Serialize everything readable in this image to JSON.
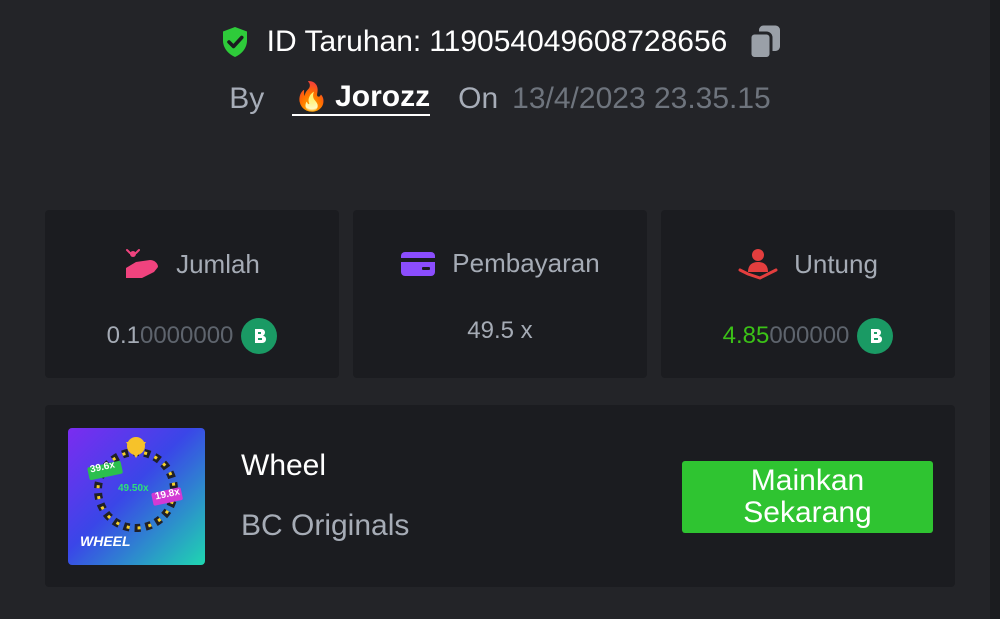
{
  "header": {
    "bet_id_label": "ID Taruhan:",
    "bet_id_value": "119054049608728656",
    "by_label": "By",
    "user": "Jorozz",
    "on_label": "On",
    "date": "13/4/2023 23.35.15"
  },
  "stats": [
    {
      "label": "Jumlah",
      "value_main": "0.1",
      "value_faded": "0000000",
      "icon": "coin-hand-icon",
      "icon_color": "#f0437e"
    },
    {
      "label": "Pembayaran",
      "value": "49.5 x",
      "icon": "card-icon",
      "icon_color": "#8b4dfd"
    },
    {
      "label": "Untung",
      "value_main": "4.85",
      "value_faded": "000000",
      "icon": "profit-hand-icon",
      "icon_color": "#e33e3e"
    }
  ],
  "game": {
    "title": "Wheel",
    "provider": "BC Originals",
    "thumb_text": "WHEEL",
    "thumb_multipliers": [
      "39.6x",
      "49.50x",
      "19.8x"
    ],
    "play_button": "Mainkan\nSekarang"
  },
  "colors": {
    "background": "#232428",
    "card": "#1b1c20",
    "accent_green": "#2fc431",
    "profit_green": "#3bc117",
    "muted_text": "#a5abb5",
    "faded_digits": "#5e646d",
    "coin": "#1a9a64"
  }
}
